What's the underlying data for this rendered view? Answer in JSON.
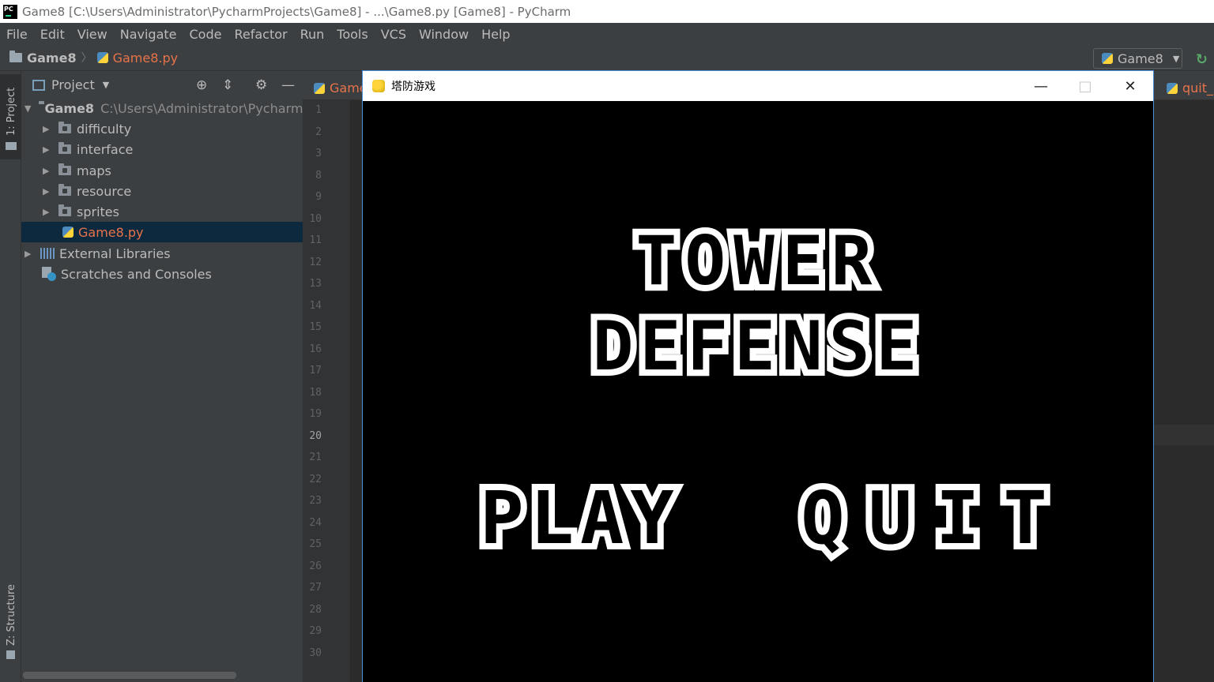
{
  "window": {
    "title": "Game8 [C:\\Users\\Administrator\\PycharmProjects\\Game8] - ...\\Game8.py [Game8] - PyCharm"
  },
  "menubar": {
    "items": [
      "File",
      "Edit",
      "View",
      "Navigate",
      "Code",
      "Refactor",
      "Run",
      "Tools",
      "VCS",
      "Window",
      "Help"
    ]
  },
  "navbar": {
    "project": "Game8",
    "file": "Game8.py",
    "run_config": "Game8"
  },
  "leftstrip": {
    "project_tab": "1: Project",
    "structure_tab": "Z: Structure"
  },
  "project_panel": {
    "title": "Project",
    "root": {
      "name": "Game8",
      "path": "C:\\Users\\Administrator\\PycharmPr"
    },
    "folders": [
      "difficulty",
      "interface",
      "maps",
      "resource",
      "sprites"
    ],
    "selected_file": "Game8.py",
    "external_libraries": "External Libraries",
    "scratches": "Scratches and Consoles"
  },
  "editor": {
    "active_tab": "Game",
    "right_tab": "quit_",
    "line_numbers": [
      "1",
      "2",
      "3",
      "8",
      "9",
      "10",
      "11",
      "12",
      "13",
      "14",
      "15",
      "16",
      "17",
      "18",
      "19",
      "20",
      "21",
      "22",
      "23",
      "24",
      "25",
      "26",
      "27",
      "28",
      "29",
      "30"
    ],
    "current_line": "20"
  },
  "game_window": {
    "title": "塔防游戏",
    "canvas": {
      "title_line1": "TOWER",
      "title_line2": "DEFENSE",
      "play": "PLAY",
      "quit": "QUIT"
    }
  },
  "colors": {
    "ide_bg": "#2b2b2b",
    "panel_bg": "#3c3f41",
    "accent_file": "#e8734a",
    "selection": "#0d293e",
    "game_bg": "#000000",
    "game_text": "#ffffff"
  }
}
